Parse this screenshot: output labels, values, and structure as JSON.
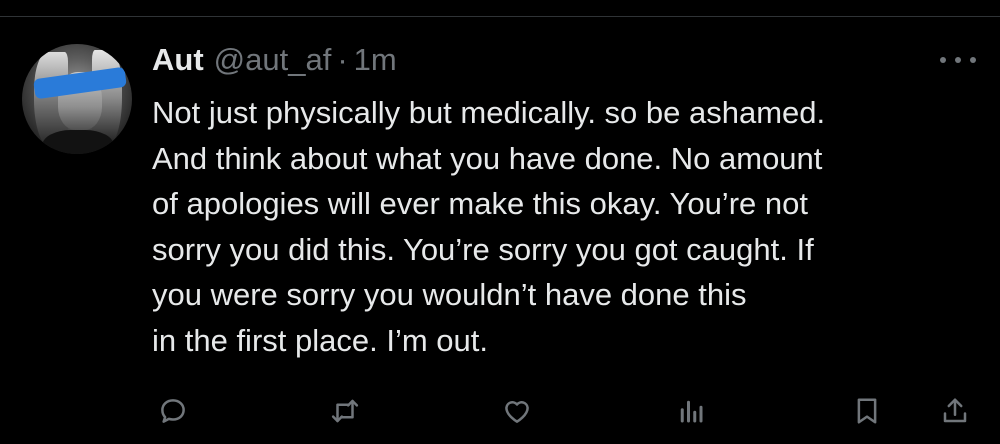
{
  "tweet": {
    "author_name": "Aut",
    "author_handle": "@aut_af",
    "separator": "·",
    "timestamp": "1m",
    "text_lines": [
      "Not just physically but medically. so be ashamed.",
      "And think about what you have done. No amount",
      "of apologies will ever make this okay. You’re not",
      "sorry you did this. You’re sorry you got caught. If",
      "you were sorry you wouldn’t have done this",
      "in the first place. I’m out."
    ]
  },
  "icons": {
    "more": "more-options-icon",
    "reply": "reply-icon",
    "retweet": "retweet-icon",
    "like": "like-icon",
    "views": "views-icon",
    "bookmark": "bookmark-icon",
    "share": "share-icon"
  },
  "colors": {
    "background": "#000000",
    "text_primary": "#e7e9ea",
    "text_secondary": "#71767b",
    "divider": "#2f3336",
    "censor_bar": "#2a7bd9"
  }
}
